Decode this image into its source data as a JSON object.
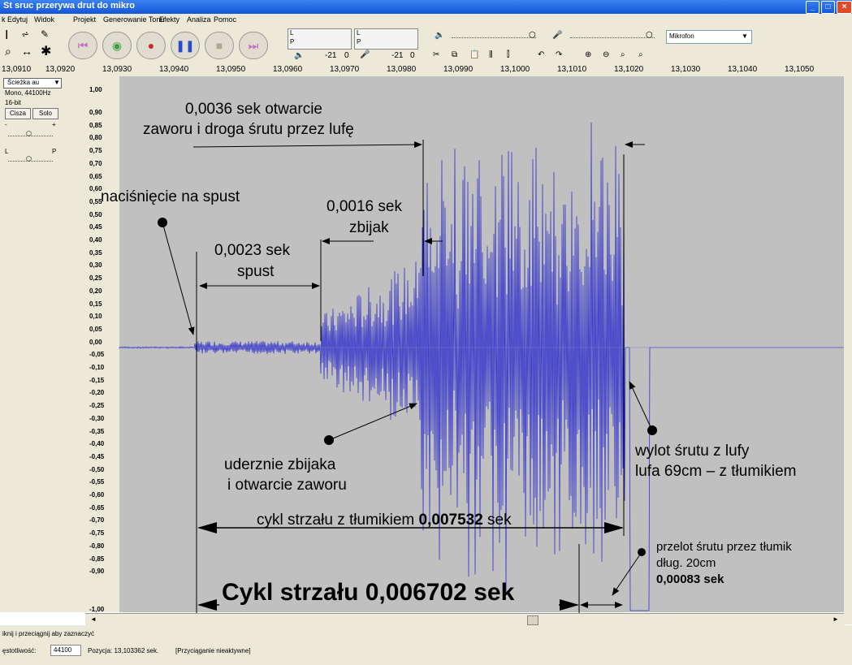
{
  "window": {
    "title": "St sruc przerywa drut do mikro"
  },
  "menu": [
    "k",
    "Edytuj",
    "Widok",
    "Projekt",
    "Generowanie Tonu",
    "Efekty",
    "Analiza",
    "Pomoc"
  ],
  "meters": {
    "L": "L",
    "P": "P",
    "speaker_db": "-21",
    "zero": "0",
    "mic_db": "-21",
    "zero2": "0"
  },
  "input_device": "Mikrofon",
  "ruler_ticks": [
    "13,0910",
    "13,0920",
    "13,0930",
    "13,0940",
    "13,0950",
    "13,0960",
    "13,0970",
    "13,0980",
    "13,0990",
    "13,1000",
    "13,1010",
    "13,1020",
    "13,1030",
    "13,1040",
    "13,1050"
  ],
  "track": {
    "name": "Ścieżka au",
    "format": "Mono, 44100Hz",
    "bits": "16-bit",
    "mute": "Cisza",
    "solo": "Solo",
    "gain_minus": "-",
    "gain_plus": "+",
    "pan_left": "L",
    "pan_right": "P"
  },
  "y_ticks": [
    "1,00",
    "0,90",
    "0,85",
    "0,80",
    "0,75",
    "0,70",
    "0,65",
    "0,60",
    "0,55",
    "0,50",
    "0,45",
    "0,40",
    "0,35",
    "0,30",
    "0,25",
    "0,20",
    "0,15",
    "0,10",
    "0,05",
    "0,00",
    "-0,05",
    "-0,10",
    "-0,15",
    "-0,20",
    "-0,25",
    "-0,30",
    "-0,35",
    "-0,40",
    "-0,45",
    "-0,50",
    "-0,55",
    "-0,60",
    "-0,65",
    "-0,70",
    "-0,75",
    "-0,80",
    "-0,85",
    "-0,90",
    "-1,00"
  ],
  "annotations": {
    "a1_line1": "0,0036 sek otwarcie",
    "a1_line2": "zaworu i droga śrutu przez lufę",
    "a2": "naciśnięcie na spust",
    "a3_line1": "0,0016 sek",
    "a3_line2": "zbijak",
    "a4_line1": "0,0023 sek",
    "a4_line2": "spust",
    "a5_line1": "uderznie zbijaka",
    "a5_line2": "i otwarcie zaworu",
    "a6_line1": "wylot śrutu z lufy",
    "a6_line2": "lufa 69cm – z tłumikiem",
    "a7_prefix": "cykl strzału z tłumikiem ",
    "a7_value": "0,007532",
    "a7_suffix": " sek",
    "a8_line1": "przelot śrutu przez tłumik",
    "a8_line2": "dług. 20cm",
    "a8_line3": "0,00083 sek",
    "a9": "Cykl strzału 0,006702 sek"
  },
  "status": {
    "hint": "iknij i przeciągnij aby zaznaczyć",
    "rate_label": "ęstotliwość:",
    "rate_value": "44100",
    "position": "Pozycja: 13,103362 sek.",
    "snap": "[Przyciąganie nieaktywne]"
  },
  "colors": {
    "waveform": "#3333cc",
    "background": "#c0c0c0",
    "titlebar": "#1f5fe0"
  }
}
